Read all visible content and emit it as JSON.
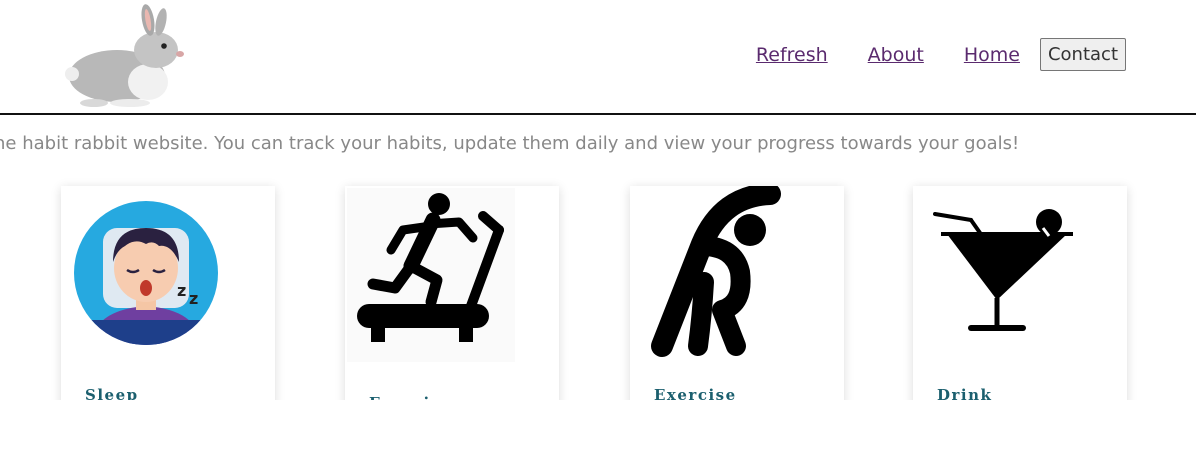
{
  "header": {
    "logo_icon": "rabbit-icon",
    "nav": {
      "refresh": "Refresh",
      "about": "About",
      "home": "Home",
      "contact": "Contact"
    },
    "link_color": "#5a2a6e"
  },
  "intro": {
    "text": "he habit rabbit website. You can track your habits, update them daily and view your progress towards your goals!"
  },
  "cards": [
    {
      "label": "Sleep",
      "icon": "sleeping-person-icon"
    },
    {
      "label": "Exercise",
      "icon": "treadmill-runner-icon"
    },
    {
      "label": "Exercise",
      "icon": "stretching-person-icon"
    },
    {
      "label": "Drink",
      "icon": "cocktail-glass-icon"
    }
  ],
  "colors": {
    "card_label": "#1b5f6e",
    "intro_text": "#888888"
  }
}
